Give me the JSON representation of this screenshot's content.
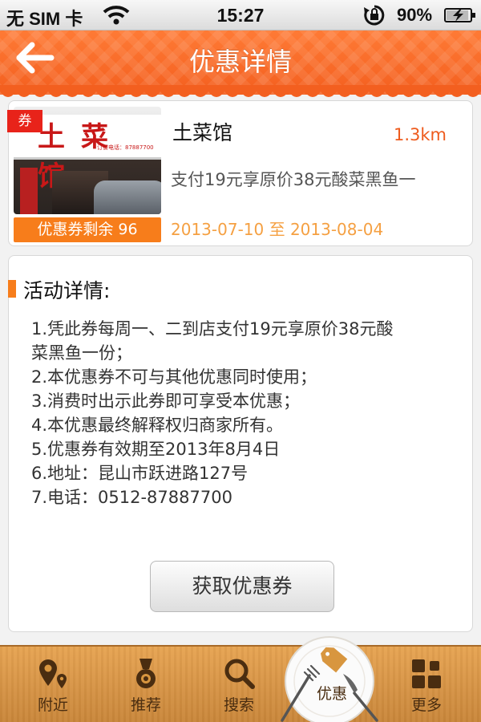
{
  "status_bar": {
    "carrier": "无 SIM 卡",
    "time": "15:27",
    "battery": "90%"
  },
  "header": {
    "title": "优惠详情",
    "back_icon": "back-arrow-icon"
  },
  "shop": {
    "coupon_tag": "券",
    "sign_text": "土菜馆",
    "sign_phone": "订餐电话：87887700",
    "name": "土菜馆",
    "distance": "1.3km",
    "deal": "支付19元享原价38元酸菜黑鱼一",
    "validity": "2013-07-10 至 2013-08-04",
    "remaining": "优惠券剩余 96"
  },
  "details": {
    "heading": "活动详情:",
    "items": [
      "1.凭此券每周一、二到店支付19元享原价38元酸",
      "菜黑鱼一份；",
      "2.本优惠券不可与其他优惠同时使用；",
      "3.消费时出示此券即可享受本优惠；",
      "4.本优惠最终解释权归商家所有。",
      "5.优惠券有效期至2013年8月4日",
      "6.地址：昆山市跃进路127号",
      "7.电话：0512-87887700"
    ],
    "button": "获取优惠券"
  },
  "tabs": [
    {
      "label": "附近",
      "icon": "location-pin-icon"
    },
    {
      "label": "推荐",
      "icon": "medal-icon"
    },
    {
      "label": "搜索",
      "icon": "search-icon"
    },
    {
      "label": "优惠",
      "icon": "tag-icon",
      "active": true
    },
    {
      "label": "更多",
      "icon": "grid-icon"
    }
  ],
  "colors": {
    "header": "#f35f1f",
    "accent": "#f77d1b",
    "distance": "#ee5b1d",
    "validity": "#f5a042",
    "tag_red": "#e8231a",
    "tab_bar": "#d8963f"
  }
}
